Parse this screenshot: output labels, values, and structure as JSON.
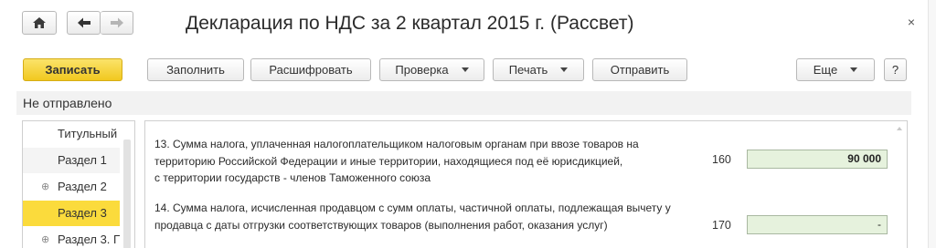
{
  "window": {
    "title": "Декларация по НДС за 2 квартал 2015 г. (Рассвет)",
    "close_glyph": "×",
    "icons": [
      "home-icon",
      "arrow-left-icon",
      "arrow-right-icon"
    ]
  },
  "toolbar": {
    "save_label": "Записать",
    "fill_label": "Заполнить",
    "decode_label": "Расшифровать",
    "check_label": "Проверка",
    "print_label": "Печать",
    "send_label": "Отправить",
    "more_label": "Еще",
    "help_label": "?"
  },
  "status": {
    "text": "Не отправлено"
  },
  "sidebar": {
    "items": [
      {
        "label": "Титульный",
        "expandable": false,
        "active": false
      },
      {
        "label": "Раздел 1",
        "expandable": false,
        "active": false
      },
      {
        "label": "Раздел 2",
        "expandable": true,
        "active": false
      },
      {
        "label": "Раздел 3",
        "expandable": false,
        "active": true
      },
      {
        "label": "Раздел 3. П",
        "expandable": true,
        "active": false
      }
    ],
    "expander_glyph": "⊕"
  },
  "content": {
    "rows": [
      {
        "lines": [
          "13. Сумма налога, уплаченная налогоплательщиком налоговым органам при ввозе товаров на",
          "территорию Российской Федерации и иные территории, находящиеся под её юрисдикцией,",
          "с территории государств - членов Таможенного союза"
        ],
        "code": "160",
        "value": "90 000"
      },
      {
        "lines": [
          "14. Сумма налога, исчисленная продавцом с сумм оплаты, частичной оплаты, подлежащая вычету у",
          "продавца с даты отгрузки соответствующих товаров (выполнения работ, оказания услуг)"
        ],
        "code": "170",
        "value": "-"
      }
    ]
  },
  "colors": {
    "accent_yellow": "#f1c81f",
    "value_field_bg": "#e6f2dd",
    "status_bar_bg": "#f2f2f2"
  }
}
